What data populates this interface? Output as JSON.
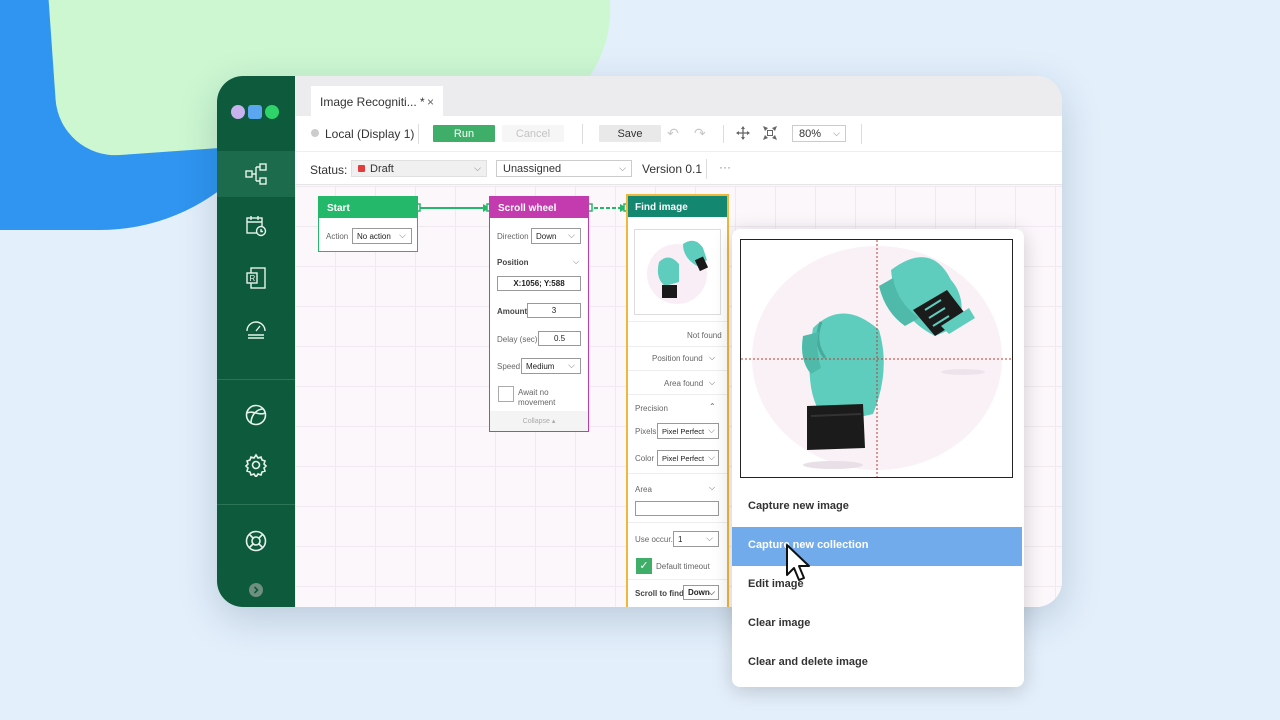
{
  "window_dots_colors": [
    "#c8b3ee",
    "#5aa6f0",
    "#2ed36a"
  ],
  "sidebar": {
    "icons": [
      "workflow-icon",
      "scheduler-icon",
      "report-icon",
      "dashboard-icon",
      "globe-icon",
      "settings-icon",
      "help-icon",
      "expand-icon"
    ]
  },
  "tab": {
    "title": "Image Recogniti... *",
    "close": "×"
  },
  "toolbar": {
    "display_label": "Local (Display 1)",
    "run": "Run",
    "cancel": "Cancel",
    "save": "Save",
    "zoom": "80%"
  },
  "statusbar": {
    "status_label": "Status:",
    "status_value": "Draft",
    "assignee": "Unassigned",
    "version": "Version 0.1",
    "more": "···"
  },
  "nodes": {
    "start": {
      "title": "Start",
      "action_label": "Action",
      "action_value": "No action"
    },
    "scroll": {
      "title": "Scroll wheel",
      "direction_label": "Direction",
      "direction_value": "Down",
      "position_label": "Position",
      "position_value": "X:1056; Y:588",
      "amount_label": "Amount",
      "amount_value": "3",
      "delay_label": "Delay (sec)",
      "delay_value": "0.5",
      "speed_label": "Speed",
      "speed_value": "Medium",
      "await_label": "Await no movement",
      "collapse": "Collapse ▴"
    },
    "find": {
      "title": "Find image",
      "not_found": "Not found",
      "position_found": "Position found",
      "area_found": "Area found",
      "precision": "Precision",
      "pixels_label": "Pixels",
      "pixels_value": "Pixel Perfect",
      "color_label": "Color",
      "color_value": "Pixel Perfect",
      "area_label": "Area",
      "use_occur_label": "Use occur.",
      "use_occur_value": "1",
      "default_timeout": "Default timeout",
      "scroll_label": "Scroll to find",
      "scroll_value": "Down"
    }
  },
  "popup": {
    "menu": [
      "Capture new image",
      "Capture new collection",
      "Edit image",
      "Clear image",
      "Clear and delete image"
    ]
  },
  "colors": {
    "sidebar": "#0d5a3c",
    "start": "#23b86a",
    "scroll": "#c43bb0",
    "find": "#13876f",
    "find_border": "#f0b73a",
    "run": "#3fae69",
    "highlight": "#72abec",
    "glove": "#5fcdbd"
  }
}
